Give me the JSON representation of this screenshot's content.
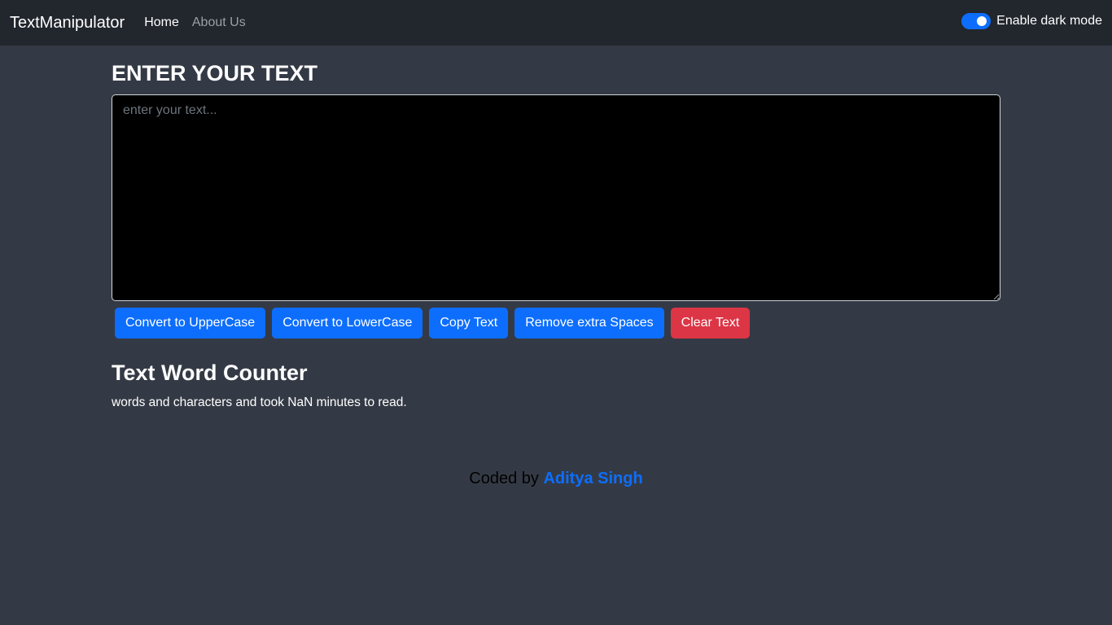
{
  "navbar": {
    "brand": "TextManipulator",
    "links": [
      {
        "label": "Home",
        "active": true
      },
      {
        "label": "About Us",
        "active": false
      }
    ],
    "dark_mode_label": "Enable dark mode",
    "dark_mode_on": true
  },
  "main": {
    "heading": "ENTER YOUR TEXT",
    "textarea_placeholder": "enter your text...",
    "textarea_value": "",
    "buttons": [
      {
        "label": "Convert to UpperCase",
        "color": "#0d6efd"
      },
      {
        "label": "Convert to LowerCase",
        "color": "#0d6efd"
      },
      {
        "label": "Copy Text",
        "color": "#0d6efd"
      },
      {
        "label": "Remove extra Spaces",
        "color": "#0d6efd"
      },
      {
        "label": "Clear Text",
        "color": "#dc3545"
      }
    ]
  },
  "counter": {
    "title": "Text Word Counter",
    "summary": "words and characters and took NaN minutes to read."
  },
  "footer": {
    "prefix": "Coded by",
    "author": "Aditya Singh"
  },
  "colors": {
    "accent": "#0d6efd",
    "danger": "#dc3545",
    "navbar_bg": "#22262d",
    "page_bg": "#343a45"
  }
}
